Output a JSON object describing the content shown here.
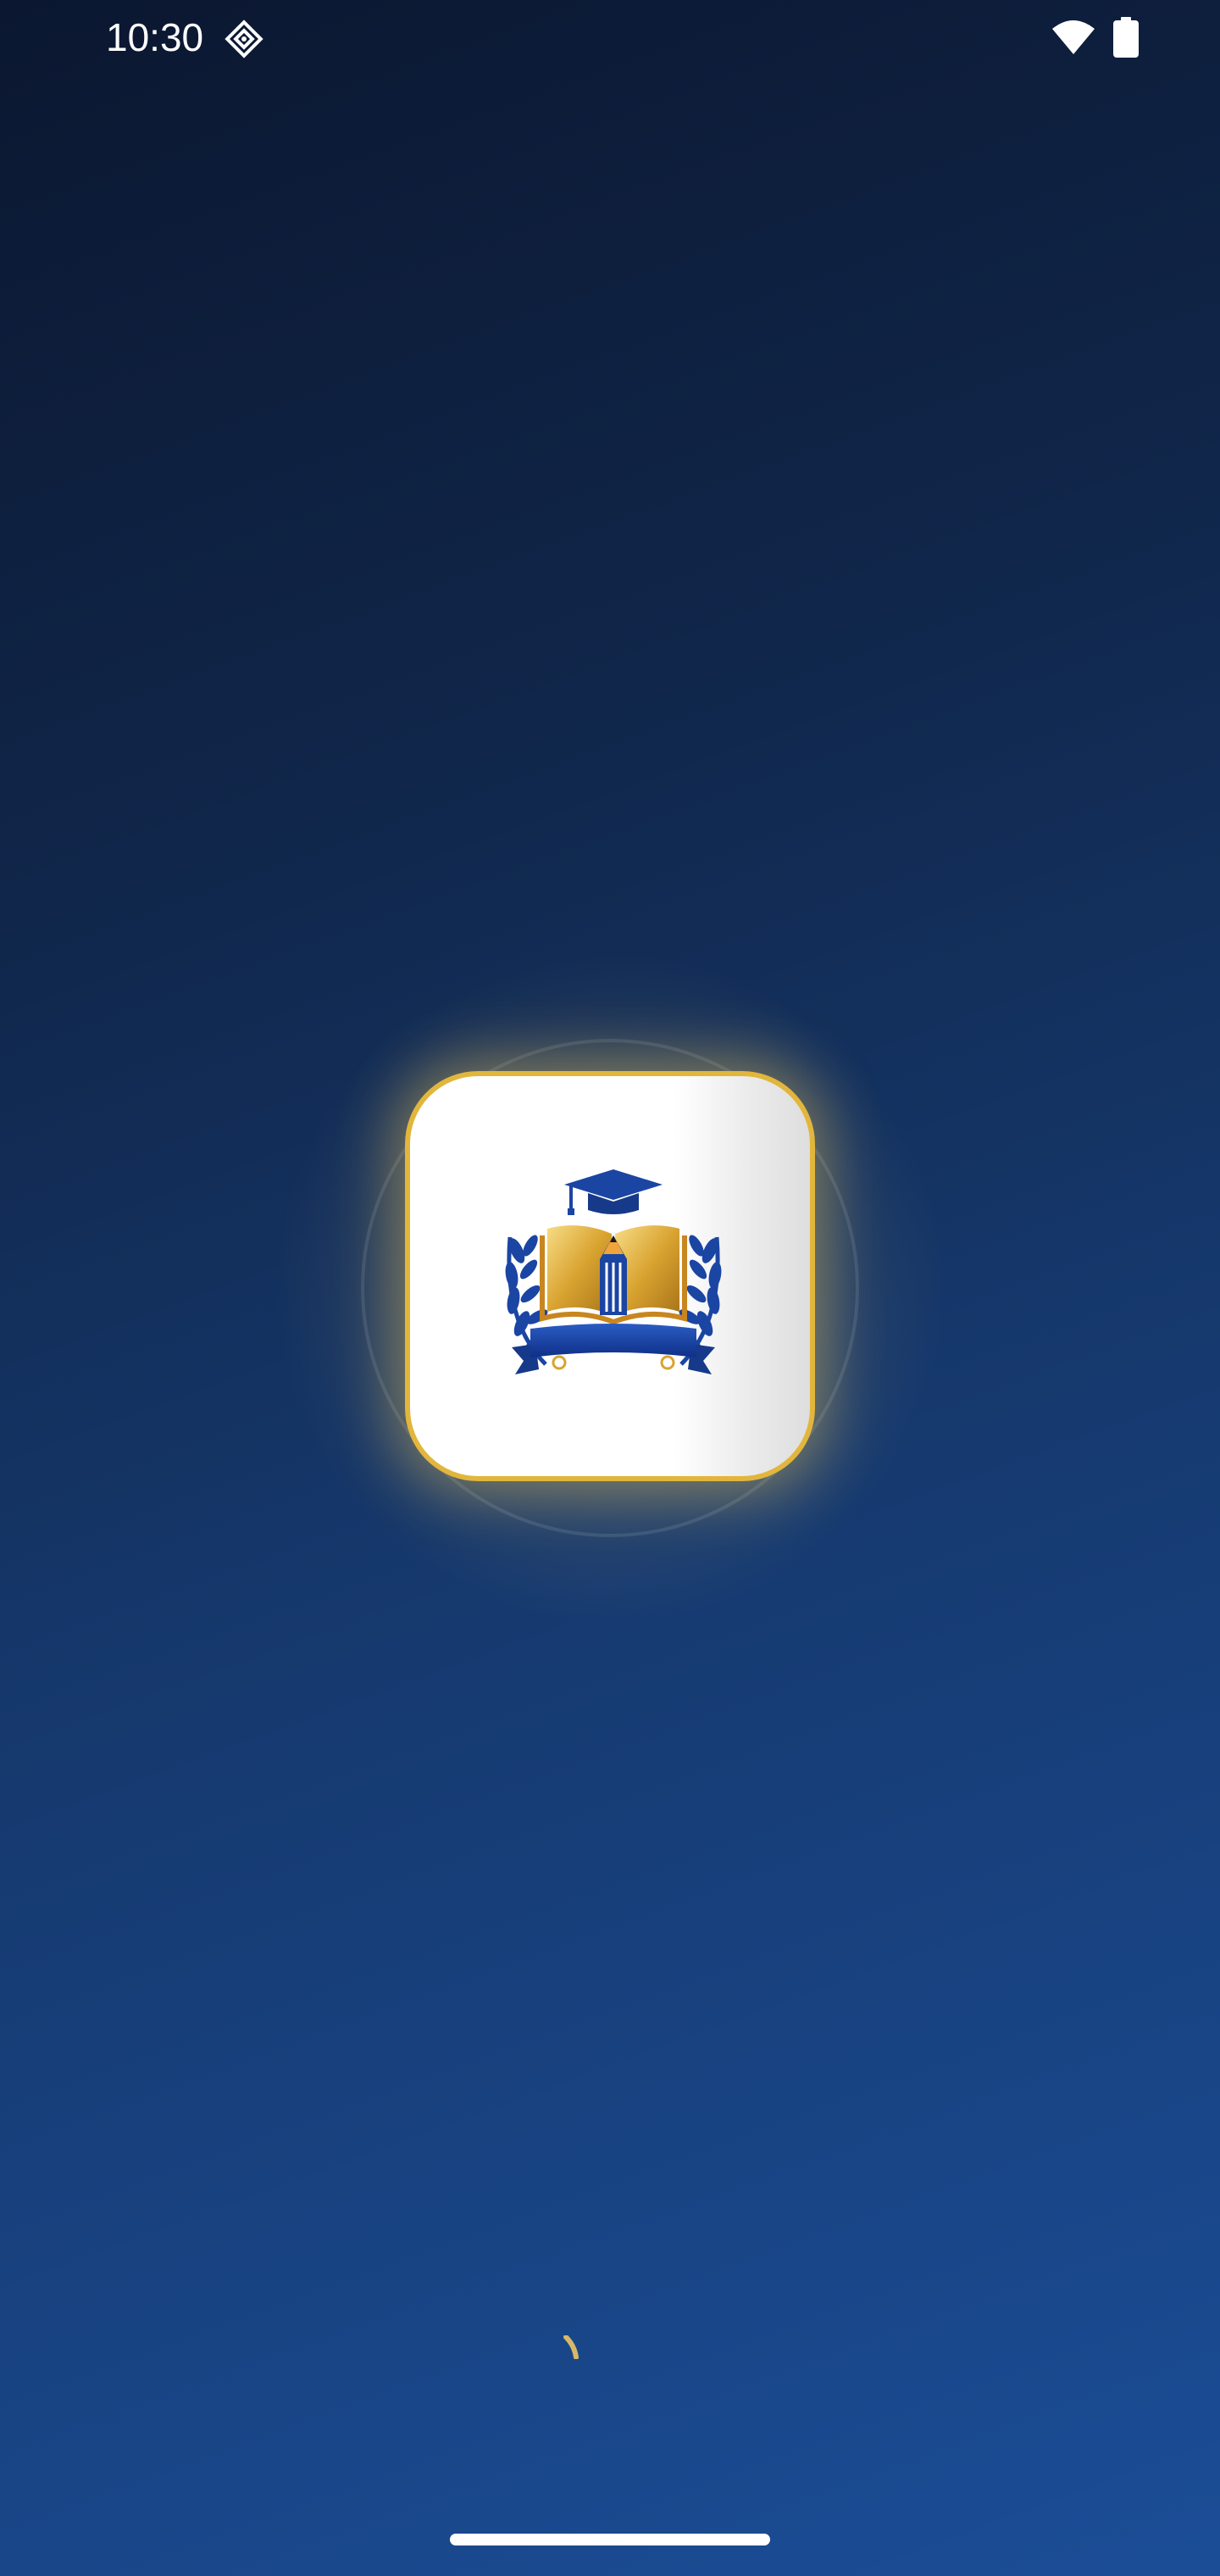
{
  "status_bar": {
    "time": "10:30",
    "icons": [
      "app-notification-icon",
      "wifi-icon",
      "battery-icon"
    ]
  },
  "splash": {
    "logo": "academy-crest-logo",
    "loading": true
  },
  "colors": {
    "background_top": "#0b1730",
    "background_bottom": "#1b4d97",
    "accent_gold": "#e2b63c",
    "crest_blue": "#1b45a3"
  }
}
